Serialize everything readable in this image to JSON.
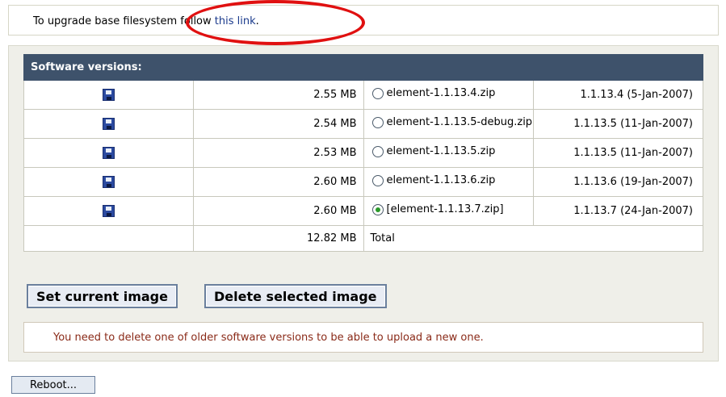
{
  "notice": {
    "text": "To upgrade base filesystem follow",
    "link_label": "this link",
    "after_link": "."
  },
  "versions": {
    "header": "Software versions:",
    "rows": [
      {
        "size": "2.55 MB",
        "name": "element-1.1.13.4.zip",
        "version": "1.1.13.4 (5-Jan-2007)",
        "selected": false
      },
      {
        "size": "2.54 MB",
        "name": "element-1.1.13.5-debug.zip",
        "version": "1.1.13.5 (11-Jan-2007)",
        "selected": false
      },
      {
        "size": "2.53 MB",
        "name": "element-1.1.13.5.zip",
        "version": "1.1.13.5 (11-Jan-2007)",
        "selected": false
      },
      {
        "size": "2.60 MB",
        "name": "element-1.1.13.6.zip",
        "version": "1.1.13.6 (19-Jan-2007)",
        "selected": false
      },
      {
        "size": "2.60 MB",
        "name": "[element-1.1.13.7.zip]",
        "version": "1.1.13.7 (24-Jan-2007)",
        "selected": true
      }
    ],
    "total_size": "12.82 MB",
    "total_label": "Total"
  },
  "buttons": {
    "set_current": "Set current image",
    "delete_selected": "Delete selected image",
    "reboot": "Reboot..."
  },
  "warning": "You need to delete one of older software versions to be able to upload a new one.",
  "colors": {
    "header_bg": "#3e526b",
    "panel_bg": "#efefe9",
    "warning_text": "#8a2a18",
    "link": "#1a3a8c",
    "annotation": "#e01010",
    "selected_radio": "#2a9a2a"
  },
  "icons": {
    "row_action": "floppy-disk-icon"
  }
}
